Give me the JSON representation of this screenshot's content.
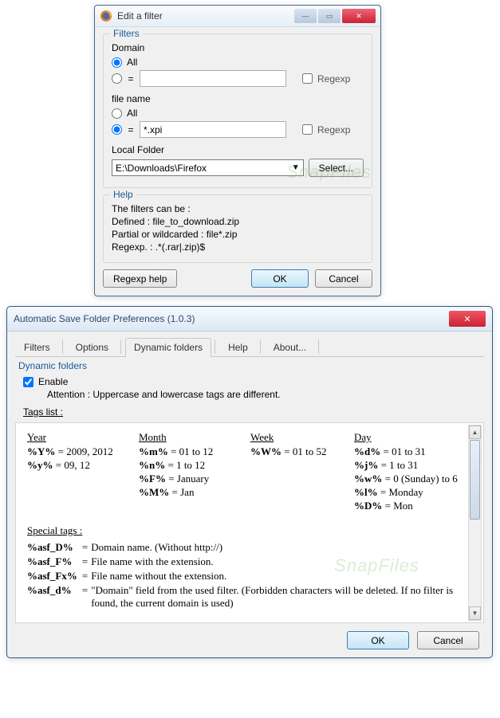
{
  "window1": {
    "title": "Edit a filter",
    "filters_group": "Filters",
    "domain_label": "Domain",
    "all_label": "All",
    "regexp_label": "Regexp",
    "domain_value": "",
    "filename_label": "file name",
    "filename_value": "*.xpi",
    "folder_label": "Local Folder",
    "folder_value": "E:\\Downloads\\Firefox",
    "select_btn": "Select...",
    "help_group": "Help",
    "help_line1": "The filters can be :",
    "help_line2": "Defined : file_to_download.zip",
    "help_line3": "Partial or wildcarded : file*.zip",
    "help_line4": "Regexp. : .*(.rar|.zip)$",
    "regexp_help_btn": "Regexp help",
    "ok_btn": "OK",
    "cancel_btn": "Cancel"
  },
  "window2": {
    "title": "Automatic Save Folder Preferences (1.0.3)",
    "tabs": [
      "Filters",
      "Options",
      "Dynamic folders",
      "Help",
      "About..."
    ],
    "active_tab": 2,
    "section": "Dynamic folders",
    "enable_label": "Enable",
    "attention": "Attention : Uppercase and lowercase tags are different.",
    "tags_list_label": "Tags list :",
    "columns": {
      "year": {
        "header": "Year",
        "items": [
          {
            "tag": "%Y%",
            "val": "2009, 2012"
          },
          {
            "tag": "%y%",
            "val": "09, 12"
          }
        ]
      },
      "month": {
        "header": "Month",
        "items": [
          {
            "tag": "%m%",
            "val": "01 to 12"
          },
          {
            "tag": "%n%",
            "val": "1 to 12"
          },
          {
            "tag": "%F%",
            "val": "January"
          },
          {
            "tag": "%M%",
            "val": "Jan"
          }
        ]
      },
      "week": {
        "header": "Week",
        "items": [
          {
            "tag": "%W%",
            "val": "01 to 52"
          }
        ]
      },
      "day": {
        "header": "Day",
        "items": [
          {
            "tag": "%d%",
            "val": "01 to 31"
          },
          {
            "tag": "%j%",
            "val": "1 to 31"
          },
          {
            "tag": "%w%",
            "val": "0 (Sunday) to 6"
          },
          {
            "tag": "%l%",
            "val": "Monday"
          },
          {
            "tag": "%D%",
            "val": "Mon"
          }
        ]
      }
    },
    "special_header": "Special tags :",
    "special": [
      {
        "tag": "%asf_D%",
        "desc": "Domain name. (Without http://)"
      },
      {
        "tag": "%asf_F%",
        "desc": "File name with the extension."
      },
      {
        "tag": "%asf_Fx%",
        "desc": "File name without the extension."
      },
      {
        "tag": "%asf_d%",
        "desc": "\"Domain\" field from the used filter. (Forbidden characters will be deleted. If no filter is found, the current domain is used)"
      }
    ],
    "ok_btn": "OK",
    "cancel_btn": "Cancel"
  },
  "watermark": "SnapFiles"
}
